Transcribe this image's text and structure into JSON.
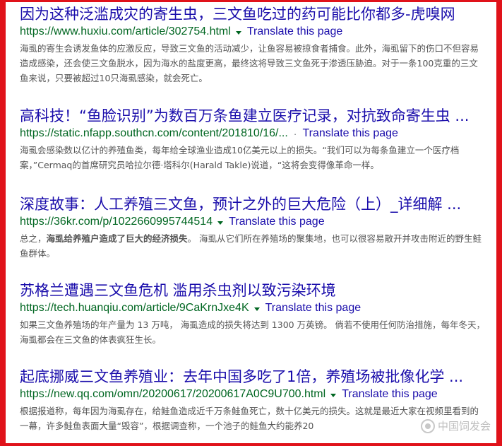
{
  "results": [
    {
      "title": "因为这种泛滥成灾的寄生虫，三文鱼吃过的药可能比你都多-虎嗅网",
      "url": "https://www.huxiu.com/article/302754.html",
      "show_dots": false,
      "translate": "Translate this page",
      "snippet": [
        {
          "t": "海虱的寄生会诱发鱼体的应激反应，导致三文鱼的活动减少，让鱼容易被掠食者捕食。此外，海虱留下的伤口不但容易造成感染，还会使三文鱼脱水，因为海水的盐度更高，最终这将导致三文鱼死于渗透压胁迫。对于一条100克重的三文鱼来说，只要被超过10只海虱感染，就会死亡。",
          "b": false
        }
      ]
    },
    {
      "title": "高科技！“鱼脸识别”为数百万条鱼建立医疗记录，对抗致命寄生虫 ...",
      "url": "https://static.nfapp.southcn.com/content/201810/16/...",
      "show_dots": true,
      "translate": "Translate this page",
      "snippet": [
        {
          "t": "海虱会感染数以亿计的养殖鱼类，每年给全球渔业造成10亿美元以上的损失。“我们可以为每条鱼建立一个医疗档案，”Cermaq的首席研究员哈拉尔德·塔科尔(Harald Takle)说道，“这将会变得像革命一样。",
          "b": false
        }
      ]
    },
    {
      "title": "深度故事：人工养殖三文鱼，预计之外的巨大危险（上）_详细解 ...",
      "url": "https://36kr.com/p/1022660995744514",
      "show_dots": false,
      "translate": "Translate this page",
      "snippet": [
        {
          "t": "总之，",
          "b": false
        },
        {
          "t": "海虱给养殖户造成了巨大的经济损失",
          "b": true
        },
        {
          "t": "。 海虱从它们所在养殖场的聚集地，也可以很容易散开并攻击附近的野生鲑鱼群体。",
          "b": false
        }
      ]
    },
    {
      "title": "苏格兰遭遇三文鱼危机 滥用杀虫剂以致污染环境",
      "url": "https://tech.huanqiu.com/article/9CaKrnJxe4K",
      "show_dots": false,
      "translate": "Translate this page",
      "snippet": [
        {
          "t": "如果三文鱼养殖场的年产量为 13 万吨， 海虱造成的损失将达到 1300 万英镑。 倘若不使用任何防治措施，每年冬天，海虱都会在三文鱼的体表疯狂生长。",
          "b": false
        }
      ]
    },
    {
      "title": "起底挪威三文鱼养殖业：去年中国多吃了1倍，养殖场被批像化学 ...",
      "url": "https://new.qq.com/omn/20200617/20200617A0C9U700.html",
      "show_dots": false,
      "translate": "Translate this page",
      "snippet": [
        {
          "t": "根据报道称，每年因为海虱存在，给鲑鱼造成近千万条鲑鱼死亡，数十亿美元的损失。这就是最近大家在视频里看到的一幕，许多鲑鱼表面大量“毁容”，根据调查称，一个池子的鲑鱼大约能养20",
          "b": false
        }
      ]
    }
  ],
  "watermark": "中国饲发会"
}
